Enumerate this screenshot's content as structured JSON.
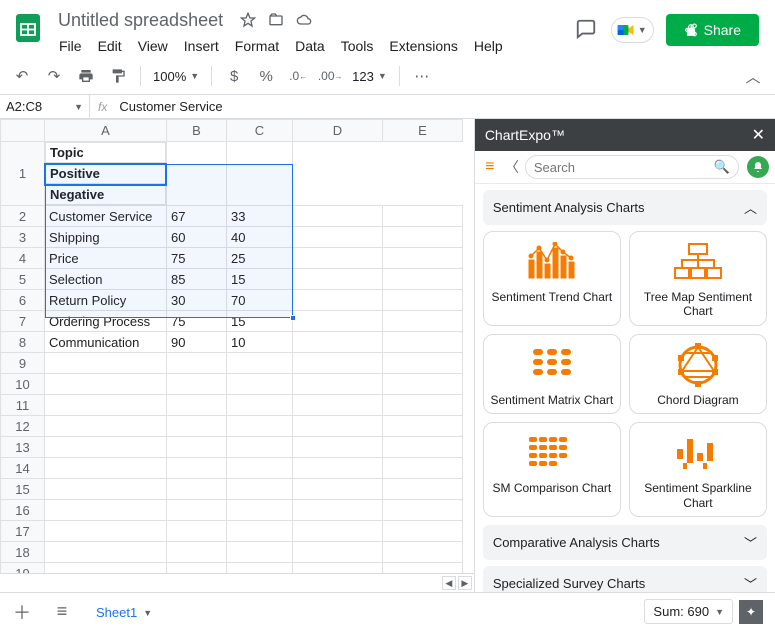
{
  "doc_title": "Untitled spreadsheet",
  "menu": [
    "File",
    "Edit",
    "View",
    "Insert",
    "Format",
    "Data",
    "Tools",
    "Extensions",
    "Help"
  ],
  "share_label": "Share",
  "toolbar": {
    "zoom": "100%",
    "num_format": "123"
  },
  "namebox": "A2:C8",
  "fx_value": "Customer Service",
  "columns": [
    "A",
    "B",
    "C",
    "D",
    "E"
  ],
  "headers": {
    "A": "Topic",
    "B": "Positive",
    "C": "Negative"
  },
  "rows": [
    {
      "A": "Customer Service",
      "B": "67",
      "C": "33"
    },
    {
      "A": "Shipping",
      "B": "60",
      "C": "40"
    },
    {
      "A": "Price",
      "B": "75",
      "C": "25"
    },
    {
      "A": "Selection",
      "B": "85",
      "C": "15"
    },
    {
      "A": "Return Policy",
      "B": "30",
      "C": "70"
    },
    {
      "A": "Ordering Process",
      "B": "75",
      "C": "15"
    },
    {
      "A": "Communication",
      "B": "90",
      "C": "10"
    }
  ],
  "sidebar": {
    "title": "ChartExpo™",
    "search_placeholder": "Search",
    "sections": {
      "open": {
        "title": "Sentiment Analysis Charts"
      },
      "closed": [
        "Comparative Analysis Charts",
        "Specialized Survey Charts"
      ]
    },
    "charts": [
      "Sentiment Trend Chart",
      "Tree Map Sentiment Chart",
      "Sentiment Matrix Chart",
      "Chord Diagram",
      "SM Comparison Chart",
      "Sentiment Sparkline Chart"
    ]
  },
  "sheet_tab": "Sheet1",
  "status": "Sum: 690"
}
